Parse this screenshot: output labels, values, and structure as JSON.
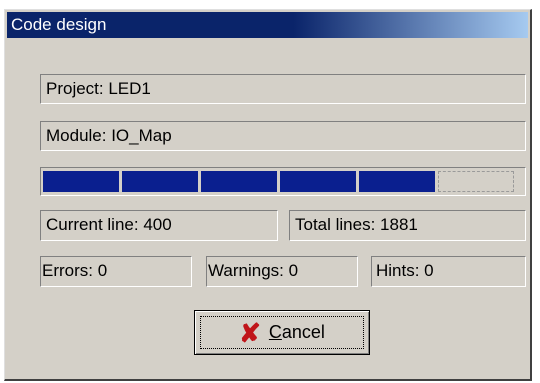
{
  "window": {
    "title": "Code design"
  },
  "project": {
    "text": "Project: LED1"
  },
  "module": {
    "text": "Module: IO_Map"
  },
  "progress": {
    "filled_segments": 5,
    "total_segments": 6,
    "fraction": 0.8333
  },
  "current_line": {
    "text": "Current line: 400"
  },
  "total_lines": {
    "text": "Total lines: 1881"
  },
  "errors": {
    "text": "Errors: 0"
  },
  "warnings": {
    "text": "Warnings: 0"
  },
  "hints": {
    "text": "Hints: 0"
  },
  "cancel_button": {
    "icon": "close-icon",
    "label_first": "C",
    "label_rest": "ancel",
    "icon_color": "#c0151a"
  },
  "colors": {
    "title_bar": "#0a246a",
    "progress_fill": "#0a1f8f",
    "dialog_bg": "#d4d0c8"
  }
}
